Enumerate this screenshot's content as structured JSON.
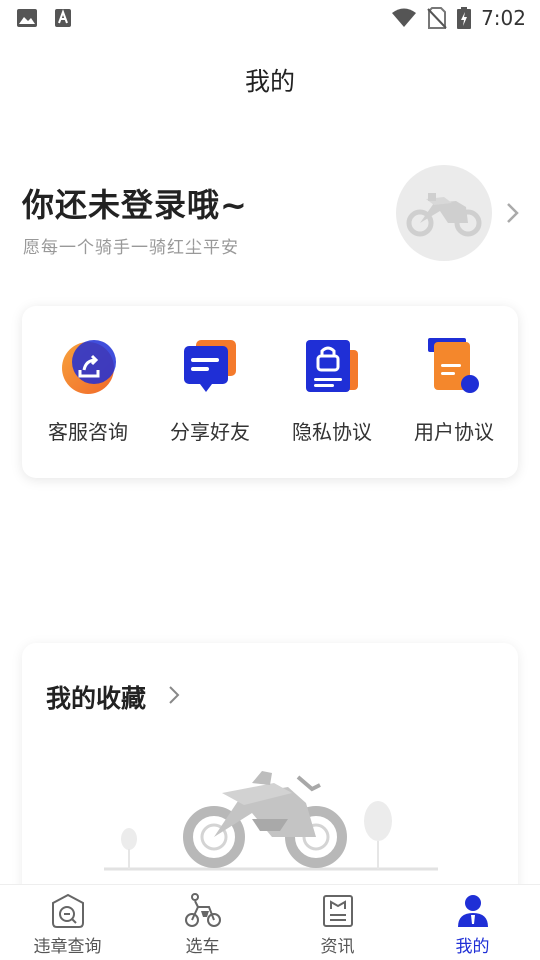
{
  "status_bar": {
    "time": "7:02",
    "icons": [
      "image-notification-icon",
      "text-notification-icon",
      "wifi-icon",
      "no-sim-icon",
      "battery-charging-icon"
    ]
  },
  "header": {
    "title": "我的"
  },
  "login": {
    "heading": "你还未登录哦~",
    "subtitle": "愿每一个骑手一骑红尘平安",
    "avatar_icon": "motorcycle-icon"
  },
  "services": [
    {
      "label": "客服咨询",
      "icon": "customer-service-icon"
    },
    {
      "label": "分享好友",
      "icon": "share-chat-icon"
    },
    {
      "label": "隐私协议",
      "icon": "privacy-lock-icon"
    },
    {
      "label": "用户协议",
      "icon": "user-agreement-icon"
    }
  ],
  "favorites": {
    "title": "我的收藏",
    "illustration": "empty-motorcycle-illustration"
  },
  "tabs": [
    {
      "label": "违章查询",
      "icon": "violation-query-icon",
      "active": false
    },
    {
      "label": "选车",
      "icon": "choose-bike-icon",
      "active": false
    },
    {
      "label": "资讯",
      "icon": "news-icon",
      "active": false
    },
    {
      "label": "我的",
      "icon": "profile-icon",
      "active": true
    }
  ],
  "colors": {
    "accent": "#1f2fd6",
    "orange": "#f47a2c",
    "text_primary": "#222222",
    "text_secondary": "#999999"
  }
}
